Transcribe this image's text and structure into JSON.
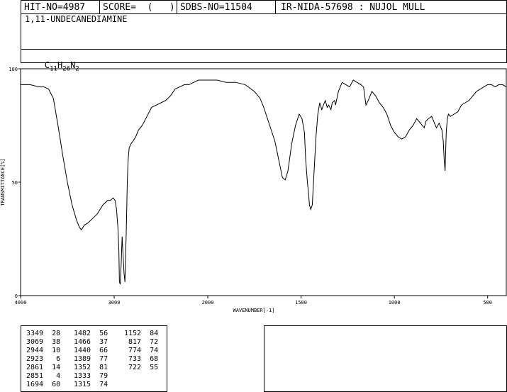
{
  "header": {
    "hit_no": "HIT-NO=4987",
    "score": "SCORE=  (   )",
    "sdbs_no": "SDBS-NO=11504",
    "ir_info": "IR-NIDA-57698 : NUJOL MULL"
  },
  "compound_name": "1,11-UNDECANEDIAMINE",
  "formula": {
    "c": "C",
    "c_n": "11",
    "h": "H",
    "h_n": "26",
    "n": "N",
    "n_n": "2"
  },
  "peak_columns": [
    [
      [
        "3349",
        "28"
      ],
      [
        "3069",
        "38"
      ],
      [
        "2944",
        "10"
      ],
      [
        "2923",
        "6"
      ],
      [
        "2861",
        "14"
      ],
      [
        "2851",
        "4"
      ],
      [
        "1694",
        "60"
      ]
    ],
    [
      [
        "1482",
        "56"
      ],
      [
        "1466",
        "37"
      ],
      [
        "1440",
        "66"
      ],
      [
        "1389",
        "77"
      ],
      [
        "1352",
        "81"
      ],
      [
        "1333",
        "79"
      ],
      [
        "1315",
        "74"
      ]
    ],
    [
      [
        "1152",
        "84"
      ],
      [
        "817",
        "72"
      ],
      [
        "774",
        "74"
      ],
      [
        "733",
        "68"
      ],
      [
        "722",
        "55"
      ]
    ]
  ],
  "chart_data": {
    "type": "line",
    "xlabel": "WAVENUMBER[-1]",
    "ylabel": "TRANSMITTANCE[%]",
    "xlim": [
      4000,
      400
    ],
    "ylim": [
      0,
      100
    ],
    "x_ticks": [
      "4000",
      "3000",
      "2000",
      "1500",
      "1000",
      "500"
    ],
    "y_ticks": [
      "100",
      "50",
      "0"
    ],
    "series": [
      {
        "x": [
          4000,
          3900,
          3800,
          3750,
          3700,
          3650,
          3600,
          3550,
          3500,
          3450,
          3400,
          3370,
          3350,
          3320,
          3280,
          3230,
          3180,
          3120,
          3070,
          3040,
          3010,
          2990,
          2975,
          2960,
          2950,
          2944,
          2935,
          2925,
          2915,
          2905,
          2895,
          2885,
          2870,
          2860,
          2851,
          2840,
          2820,
          2800,
          2770,
          2740,
          2700,
          2650,
          2600,
          2550,
          2500,
          2450,
          2400,
          2350,
          2300,
          2250,
          2200,
          2150,
          2100,
          2050,
          2000,
          1950,
          1900,
          1850,
          1800,
          1750,
          1720,
          1700,
          1680,
          1660,
          1640,
          1620,
          1600,
          1585,
          1570,
          1550,
          1530,
          1510,
          1495,
          1482,
          1475,
          1466,
          1460,
          1455,
          1448,
          1440,
          1430,
          1420,
          1410,
          1400,
          1389,
          1380,
          1370,
          1360,
          1352,
          1340,
          1333,
          1320,
          1315,
          1300,
          1280,
          1260,
          1240,
          1220,
          1200,
          1180,
          1165,
          1152,
          1140,
          1120,
          1100,
          1080,
          1060,
          1040,
          1020,
          1000,
          980,
          960,
          940,
          920,
          900,
          880,
          860,
          840,
          830,
          817,
          800,
          790,
          780,
          774,
          760,
          745,
          738,
          733,
          728,
          722,
          716,
          710,
          700,
          680,
          660,
          640,
          620,
          600,
          580,
          560,
          540,
          520,
          500,
          480,
          460,
          440,
          420,
          400
        ],
        "y": [
          93,
          93,
          92,
          92,
          91,
          87,
          75,
          62,
          50,
          40,
          33,
          30,
          29,
          31,
          32,
          34,
          36,
          40,
          42,
          42,
          43,
          42,
          38,
          30,
          20,
          6,
          5,
          14,
          26,
          18,
          10,
          6,
          30,
          50,
          60,
          65,
          67,
          68,
          70,
          73,
          75,
          79,
          83,
          84,
          85,
          86,
          88,
          91,
          92,
          93,
          93,
          94,
          95,
          95,
          95,
          95,
          94,
          94,
          93,
          90,
          87,
          83,
          78,
          73,
          68,
          60,
          52,
          51,
          55,
          67,
          75,
          80,
          78,
          72,
          60,
          50,
          45,
          40,
          38,
          40,
          55,
          70,
          80,
          85,
          82,
          84,
          86,
          83,
          84,
          82,
          85,
          86,
          84,
          90,
          94,
          93,
          92,
          95,
          94,
          93,
          92,
          84,
          86,
          90,
          88,
          85,
          83,
          80,
          75,
          72,
          70,
          69,
          70,
          73,
          75,
          78,
          76,
          74,
          77,
          78,
          79,
          77,
          75,
          74,
          76,
          73,
          68,
          60,
          55,
          72,
          78,
          80,
          79,
          80,
          81,
          84,
          85,
          86,
          88,
          90,
          91,
          92,
          93,
          93,
          92,
          93,
          93,
          92
        ]
      }
    ]
  }
}
